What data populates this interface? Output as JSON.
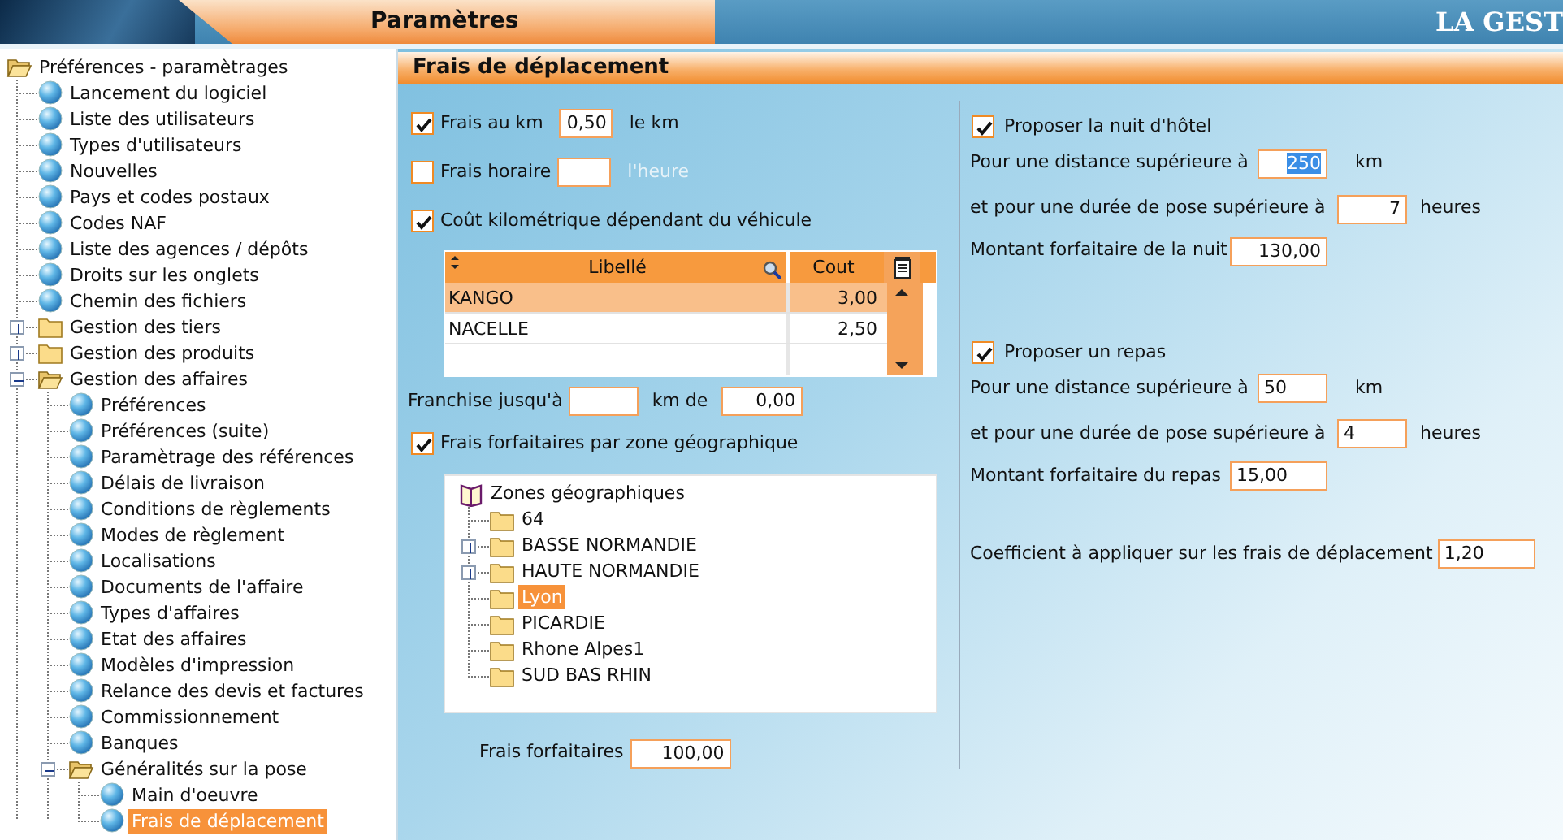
{
  "header": {
    "title": "Paramètres",
    "brand": "LA GEST"
  },
  "sidebar": {
    "tree": [
      {
        "label": "Préférences - paramètrages",
        "kind": "folder",
        "expanded": true,
        "selected": false,
        "children": [
          {
            "label": "Lancement du logiciel",
            "kind": "leaf",
            "selected": false
          },
          {
            "label": "Liste des utilisateurs",
            "kind": "leaf",
            "selected": false
          },
          {
            "label": "Types d'utilisateurs",
            "kind": "leaf",
            "selected": false
          },
          {
            "label": "Nouvelles",
            "kind": "leaf",
            "selected": false
          },
          {
            "label": "Pays et codes postaux",
            "kind": "leaf",
            "selected": false
          },
          {
            "label": "Codes NAF",
            "kind": "leaf",
            "selected": false
          },
          {
            "label": "Liste des agences / dépôts",
            "kind": "leaf",
            "selected": false
          },
          {
            "label": "Droits sur les onglets",
            "kind": "leaf",
            "selected": false
          },
          {
            "label": "Chemin des fichiers",
            "kind": "leaf",
            "selected": false
          },
          {
            "label": "Gestion des tiers",
            "kind": "folder",
            "expanded": false,
            "selected": false
          },
          {
            "label": "Gestion des produits",
            "kind": "folder",
            "expanded": false,
            "selected": false
          },
          {
            "label": "Gestion des affaires",
            "kind": "folder",
            "expanded": true,
            "selected": false,
            "children": [
              {
                "label": "Préférences",
                "kind": "leaf",
                "selected": false
              },
              {
                "label": "Préférences (suite)",
                "kind": "leaf",
                "selected": false
              },
              {
                "label": "Paramètrage des références",
                "kind": "leaf",
                "selected": false
              },
              {
                "label": "Délais de livraison",
                "kind": "leaf",
                "selected": false
              },
              {
                "label": "Conditions de règlements",
                "kind": "leaf",
                "selected": false
              },
              {
                "label": "Modes de règlement",
                "kind": "leaf",
                "selected": false
              },
              {
                "label": "Localisations",
                "kind": "leaf",
                "selected": false
              },
              {
                "label": "Documents de l'affaire",
                "kind": "leaf",
                "selected": false
              },
              {
                "label": "Types d'affaires",
                "kind": "leaf",
                "selected": false
              },
              {
                "label": "Etat des affaires",
                "kind": "leaf",
                "selected": false
              },
              {
                "label": "Modèles d'impression",
                "kind": "leaf",
                "selected": false
              },
              {
                "label": "Relance des devis et factures",
                "kind": "leaf",
                "selected": false
              },
              {
                "label": "Commissionnement",
                "kind": "leaf",
                "selected": false
              },
              {
                "label": "Banques",
                "kind": "leaf",
                "selected": false
              },
              {
                "label": "Généralités sur la pose",
                "kind": "folder",
                "expanded": true,
                "selected": false,
                "children": [
                  {
                    "label": "Main d'oeuvre",
                    "kind": "leaf",
                    "selected": false
                  },
                  {
                    "label": "Frais de déplacement",
                    "kind": "leaf",
                    "selected": true
                  }
                ]
              }
            ]
          }
        ]
      }
    ]
  },
  "section_title": "Frais de déplacement",
  "left": {
    "options": [
      {
        "label": "Frais au km",
        "checked": true,
        "value": "0,50",
        "unit": "le km"
      },
      {
        "label": "Frais horaire",
        "checked": false,
        "unit": "l'heure"
      },
      {
        "label": "Coût kilométrique dépendant du véhicule",
        "checked": true
      }
    ],
    "vehicle_table": {
      "columns": [
        "Libellé",
        "Cout"
      ],
      "rows": [
        {
          "cells": [
            "KANGO",
            "3,00"
          ],
          "selected": true
        },
        {
          "cells": [
            "NACELLE",
            "2,50"
          ],
          "selected": false
        }
      ]
    },
    "franchise": {
      "label": "Franchise jusqu'à",
      "unit": "km de",
      "value": "0,00"
    },
    "zone_option": {
      "label": "Frais forfaitaires par zone géographique",
      "checked": true
    },
    "zone_tree": {
      "label": "Zones géographiques",
      "children": [
        {
          "label": "64",
          "selected": false
        },
        {
          "label": "BASSE NORMANDIE",
          "expanded": false,
          "selected": false
        },
        {
          "label": "HAUTE NORMANDIE",
          "expanded": false,
          "selected": false
        },
        {
          "label": "Lyon",
          "selected": true
        },
        {
          "label": "PICARDIE",
          "selected": false
        },
        {
          "label": "Rhone Alpes1",
          "selected": false
        },
        {
          "label": "SUD BAS RHIN",
          "selected": false
        }
      ]
    },
    "flat_fee": {
      "label": "Frais forfaitaires",
      "value": "100,00"
    }
  },
  "right": {
    "groups": [
      {
        "label": "Proposer la nuit d'hôtel",
        "checked": true,
        "fields": [
          {
            "label": "Pour une distance supérieure à",
            "value": "250",
            "unit": "km",
            "text_selected": true
          },
          {
            "label": "et pour une durée de pose supérieure à",
            "value": "7",
            "unit": "heures",
            "text_selected": false
          },
          {
            "label": "Montant forfaitaire de la nuit",
            "value": "130,00",
            "text_selected": false
          }
        ]
      },
      {
        "label": "Proposer un repas",
        "checked": true,
        "fields": [
          {
            "label": "Pour une distance supérieure à",
            "value": "50",
            "unit": "km",
            "text_selected": false
          },
          {
            "label": "et pour une durée de pose supérieure à",
            "value": "4",
            "unit": "heures",
            "text_selected": false
          },
          {
            "label": "Montant forfaitaire du repas",
            "value": "15,00",
            "text_selected": false
          }
        ]
      }
    ],
    "coefficient": {
      "label": "Coefficient à appliquer sur les frais de déplacement",
      "value": "1,20"
    }
  }
}
